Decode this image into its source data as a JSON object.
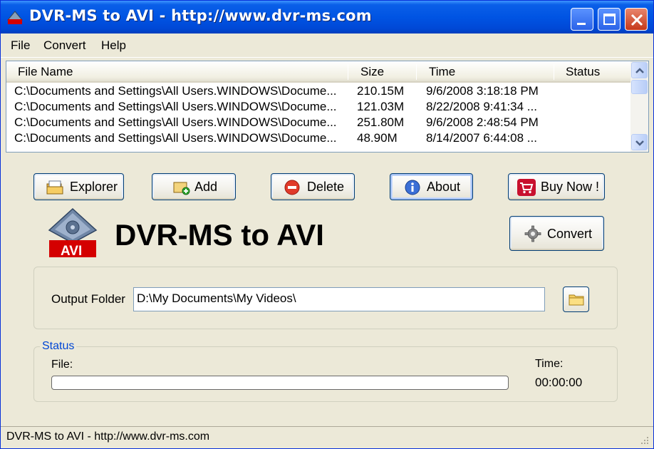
{
  "window": {
    "title": "DVR-MS to AVI - http://www.dvr-ms.com"
  },
  "menu": [
    "File",
    "Convert",
    "Help"
  ],
  "list": {
    "columns": [
      "File Name",
      "Size",
      "Time",
      "Status"
    ],
    "rows": [
      {
        "name": "C:\\Documents and Settings\\All Users.WINDOWS\\Docume...",
        "size": "210.15M",
        "time": "9/6/2008 3:18:18 PM",
        "status": ""
      },
      {
        "name": "C:\\Documents and Settings\\All Users.WINDOWS\\Docume...",
        "size": "121.03M",
        "time": "8/22/2008 9:41:34 ...",
        "status": ""
      },
      {
        "name": "C:\\Documents and Settings\\All Users.WINDOWS\\Docume...",
        "size": "251.80M",
        "time": "9/6/2008 2:48:54 PM",
        "status": ""
      },
      {
        "name": "C:\\Documents and Settings\\All Users.WINDOWS\\Docume...",
        "size": "48.90M",
        "time": "8/14/2007 6:44:08 ...",
        "status": ""
      }
    ]
  },
  "toolbar": {
    "explorer": "Explorer",
    "add": "Add",
    "delete": "Delete",
    "about": "About",
    "buy_now": "Buy Now !",
    "convert": "Convert"
  },
  "logo": {
    "badge": "AVI",
    "title": "DVR-MS to AVI"
  },
  "output": {
    "label": "Output Folder",
    "value": "D:\\My Documents\\My Videos\\"
  },
  "status": {
    "title": "Status",
    "file_label": "File:",
    "time_label": "Time:",
    "time_value": "00:00:00",
    "progress": 0
  },
  "statusbar": {
    "text": "DVR-MS to AVI - http://www.dvr-ms.com"
  },
  "colors": {
    "titlebar": "#0054e3",
    "accent": "#0046d5",
    "badge_red": "#d40000"
  },
  "icons": [
    "app-icon",
    "minimize-icon",
    "maximize-icon",
    "close-icon",
    "explorer-icon",
    "add-icon",
    "delete-icon",
    "info-icon",
    "cart-icon",
    "gear-icon",
    "folder-icon",
    "scroll-up-icon",
    "scroll-down-icon",
    "resize-grip-icon"
  ]
}
